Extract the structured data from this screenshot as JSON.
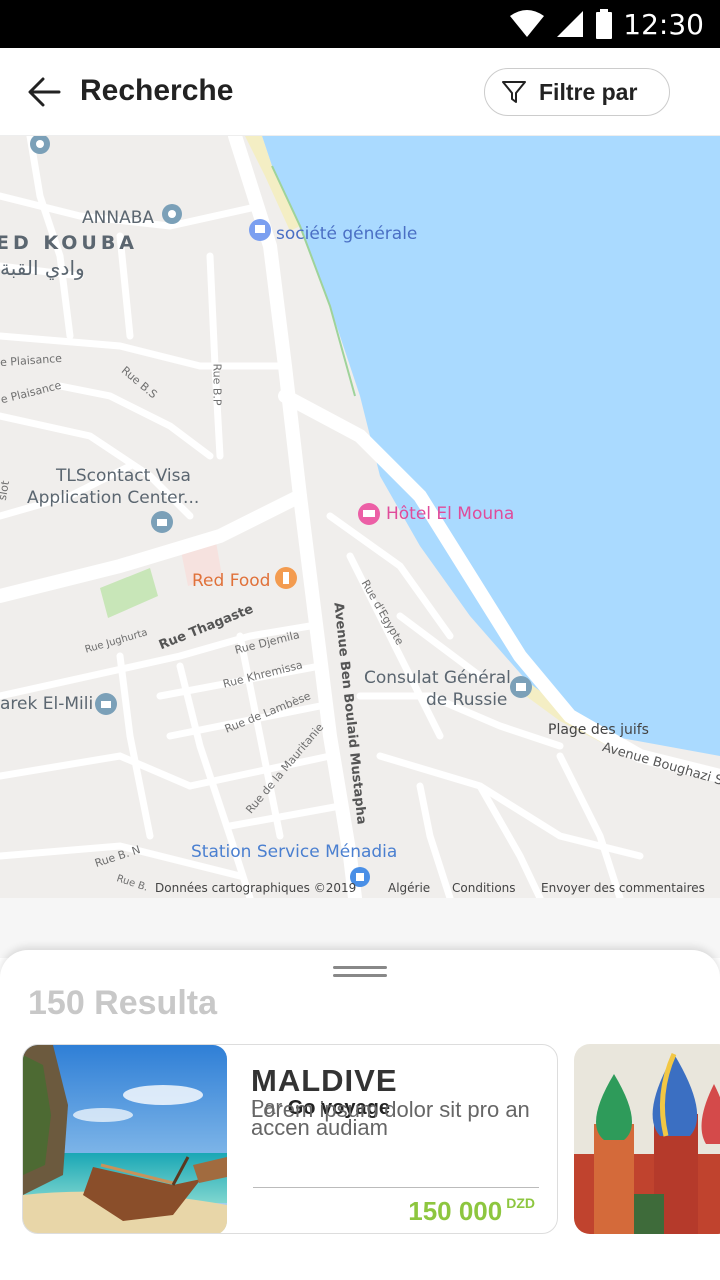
{
  "status_bar": {
    "time": "12:30"
  },
  "header": {
    "title": "Recherche",
    "filter_label": "Filtre par"
  },
  "map": {
    "labels": {
      "annaba": "ANNABA",
      "kouba": "ED KOUBA",
      "kouba_ar": "وادي القبة",
      "societe": "société générale",
      "plaisance1": "e Plaisance",
      "plaisance2": "e Plaisance",
      "rue_bs": "Rue B.S",
      "rue_bp": "Rue B.P",
      "tls1": "TLScontact Visa",
      "tls2": "Application Center...",
      "hotel": "Hôtel El Mouna",
      "redfood": "Red Food",
      "thagaste": "Rue Thagaste",
      "jughurta": "Rue Jughurta",
      "djemila": "Rue Djemila",
      "khremissa": "Rue Khremissa",
      "lambese": "Rue de Lambèse",
      "mauritanie": "Rue de la Mauritanie",
      "egypte": "Rue d'Egypte",
      "avenue_ben": "Avenue Ben Boulaid Mustapha",
      "consulat1": "Consulat Général",
      "consulat2": "de Russie",
      "plage": "Plage des juifs",
      "boughazi": "Avenue Boughazi Sa",
      "tarek": "arek El-Mili",
      "station": "Station Service Ménadia",
      "rue_bn": "Rue B. N",
      "rue_b": "Rue B.",
      "slot": "slot"
    },
    "attribution": {
      "data": "Données cartographiques ©2019",
      "country": "Algérie",
      "terms": "Conditions",
      "feedback": "Envoyer des commentaires"
    }
  },
  "results": {
    "count_label": "150 Resulta",
    "cards": [
      {
        "title": "MALDIVE",
        "by_prefix": "Par",
        "agency": "Go voyage",
        "description": "Lorem ipsum dolor sit pro an accen audiam",
        "price": "150 000",
        "currency": "DZD"
      }
    ]
  },
  "colors": {
    "accent_price": "#8dc63f",
    "water": "#aadaff",
    "map_land": "#f0eeec"
  }
}
